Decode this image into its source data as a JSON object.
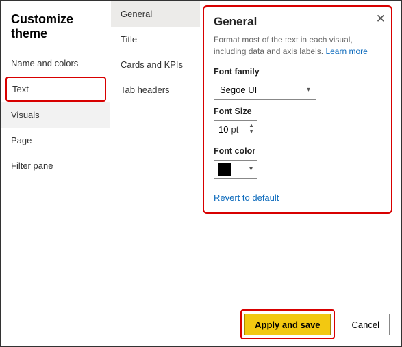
{
  "dialog": {
    "title": "Customize theme"
  },
  "left_nav": {
    "items": [
      {
        "label": "Name and colors"
      },
      {
        "label": "Text"
      },
      {
        "label": "Visuals"
      },
      {
        "label": "Page"
      },
      {
        "label": "Filter pane"
      }
    ],
    "selected_index": 1
  },
  "mid_nav": {
    "items": [
      {
        "label": "General"
      },
      {
        "label": "Title"
      },
      {
        "label": "Cards and KPIs"
      },
      {
        "label": "Tab headers"
      }
    ],
    "selected_index": 0
  },
  "panel": {
    "heading": "General",
    "description_pre": "Format most of the text in each visual, including data and axis labels. ",
    "learn_more": "Learn more",
    "font_family": {
      "label": "Font family",
      "value": "Segoe UI"
    },
    "font_size": {
      "label": "Font Size",
      "value": "10",
      "unit": "pt"
    },
    "font_color": {
      "label": "Font color",
      "value": "#000000"
    },
    "revert": "Revert to default"
  },
  "footer": {
    "apply": "Apply and save",
    "cancel": "Cancel"
  }
}
